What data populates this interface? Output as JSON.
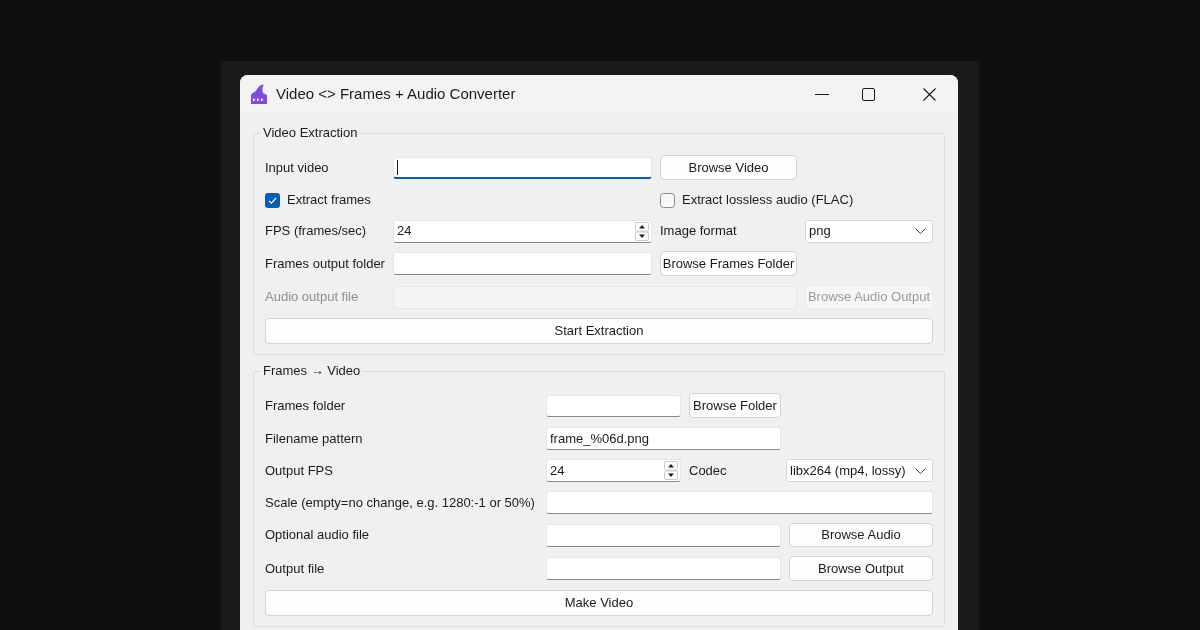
{
  "window": {
    "title": "Video <> Frames + Audio Converter"
  },
  "video_extraction": {
    "title": "Video Extraction",
    "input_video": {
      "label": "Input video",
      "focused": true,
      "button": "Browse Video"
    },
    "options": [
      {
        "label": "Extract frames",
        "checked": true
      },
      {
        "label": "Extract lossless audio (FLAC)",
        "checked": false
      }
    ],
    "fps": {
      "label": "FPS (frames/sec)",
      "value": "24"
    },
    "image_format": {
      "label": "Image format",
      "value": "png"
    },
    "frames_output_folder": {
      "label": "Frames output folder",
      "button": "Browse Frames Folder"
    },
    "audio_output_file": {
      "label": "Audio output file",
      "disabled": true,
      "button": "Browse Audio Output"
    },
    "action": "Start Extraction"
  },
  "frames_to_video": {
    "title": "Frames → Video",
    "frames_folder": {
      "label": "Frames folder",
      "button": "Browse Folder"
    },
    "filename_pattern": {
      "label": "Filename pattern",
      "value": "frame_%06d.png"
    },
    "output_fps": {
      "label": "Output FPS",
      "value": "24"
    },
    "codec": {
      "label": "Codec",
      "value": "libx264 (mp4, lossy)"
    },
    "scale": {
      "label": "Scale (empty=no change, e.g. 1280:-1 or 50%)"
    },
    "audio_file": {
      "label": "Optional audio file",
      "button": "Browse Audio"
    },
    "output_file": {
      "label": "Output file",
      "button": "Browse Output"
    },
    "action": "Make Video"
  }
}
